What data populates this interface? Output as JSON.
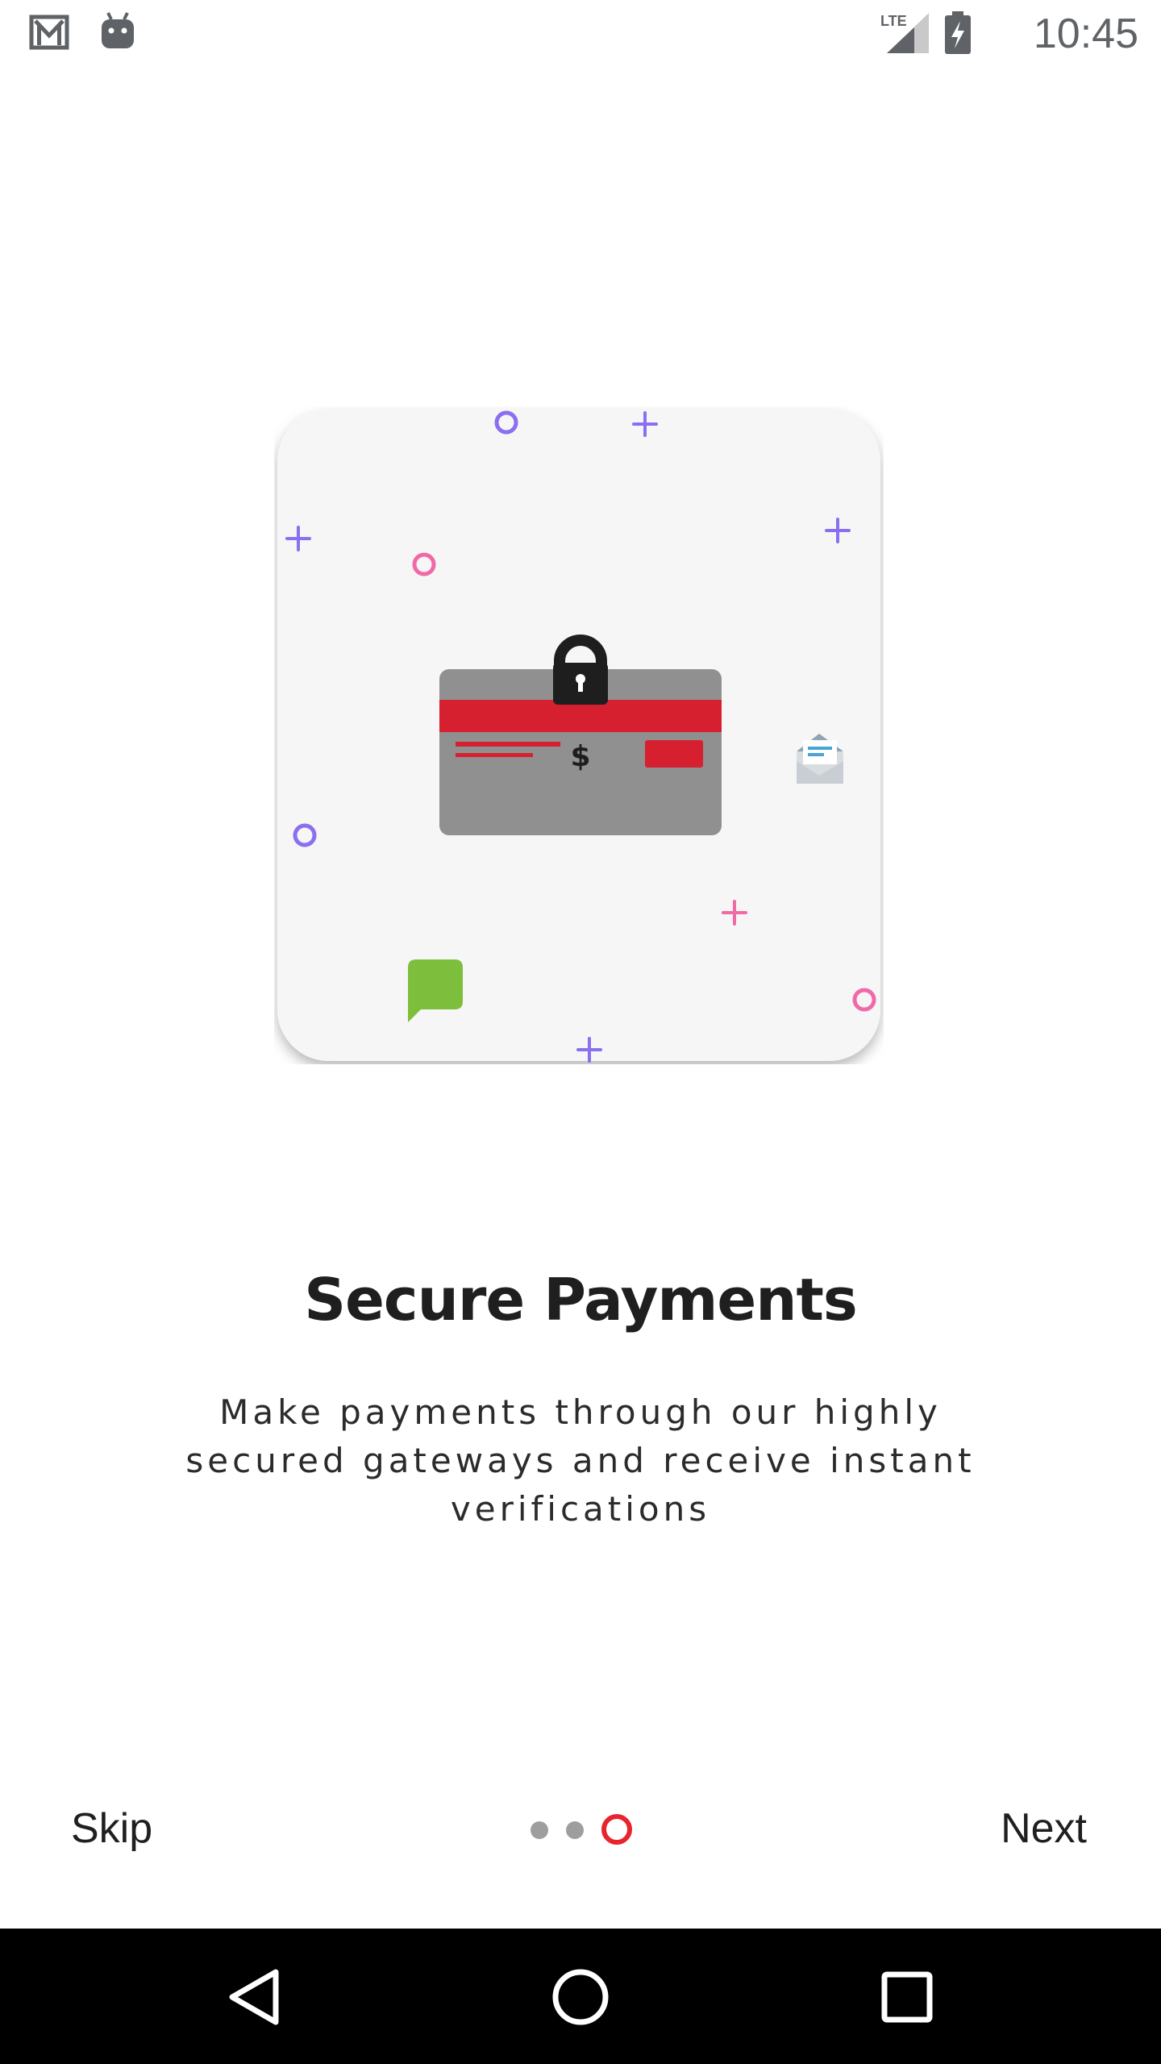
{
  "status_bar": {
    "time": "10:45",
    "network": "LTE",
    "icons": [
      "gmail-icon",
      "android-icon",
      "signal-icon",
      "battery-charging-icon"
    ]
  },
  "slide": {
    "title": "Secure Payments",
    "description": "Make payments through our highly secured gateways and receive instant verifications",
    "illustration": "secure-payment-card-illustration"
  },
  "pager": {
    "total_pages": 3,
    "current_page": 3
  },
  "controls": {
    "skip_label": "Skip",
    "next_label": "Next"
  },
  "nav_bar": {
    "icons": [
      "back-icon",
      "home-icon",
      "recents-icon"
    ]
  },
  "colors": {
    "accent": "#e8242e",
    "card_background": "#f6f6f6",
    "credit_card": "#909090",
    "decoration_purple": "#8b6ff0",
    "decoration_pink": "#f06aa8",
    "chat_bubble": "#7dbf3c"
  }
}
